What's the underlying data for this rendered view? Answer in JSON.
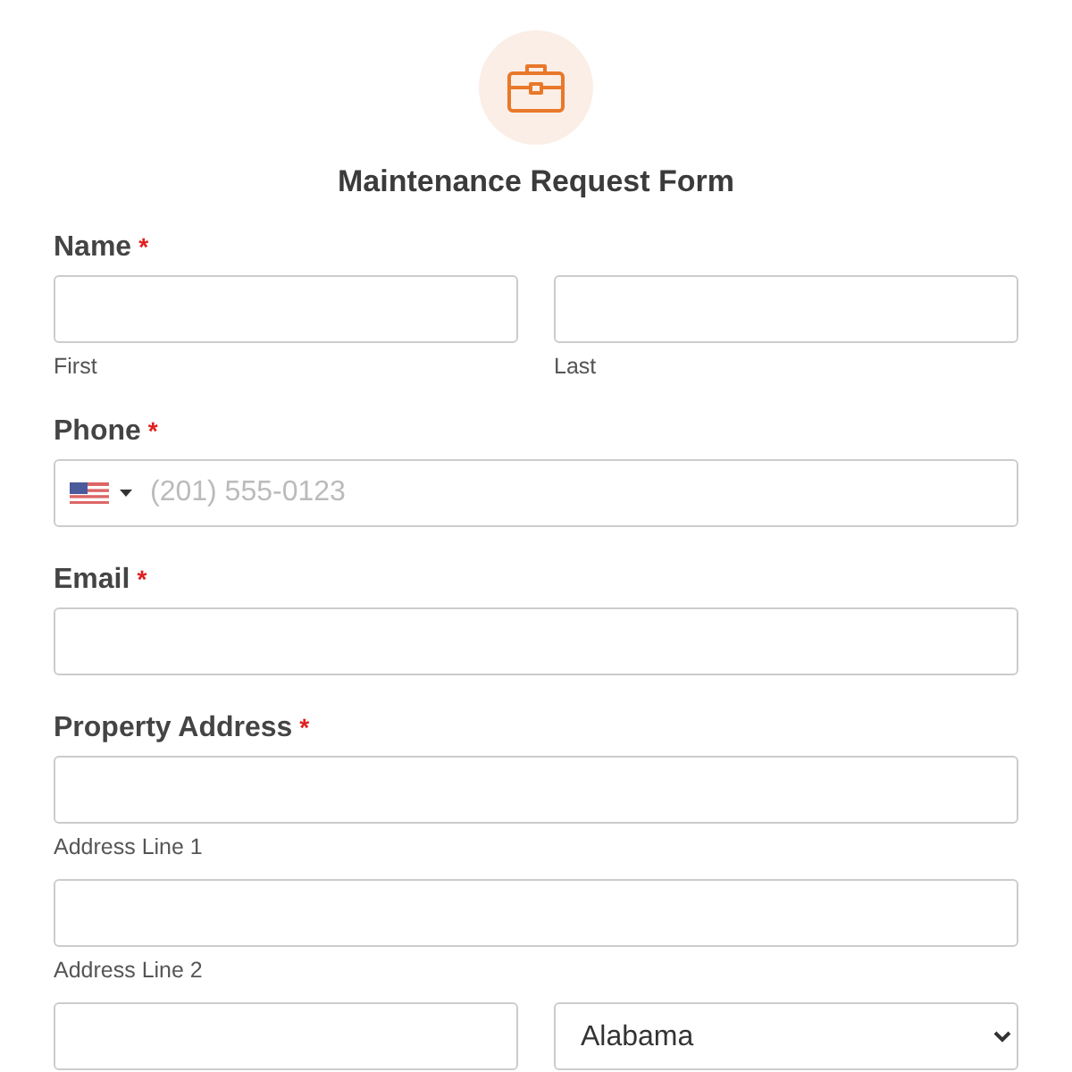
{
  "form": {
    "title": "Maintenance Request Form"
  },
  "fields": [
    {
      "label": "Name",
      "required_mark": "*",
      "rows": [
        [
          {
            "kind": "input",
            "sublabel": "First"
          },
          {
            "kind": "input",
            "sublabel": "Last"
          }
        ]
      ]
    },
    {
      "label": "Phone",
      "required_mark": "*",
      "rows": [
        [
          {
            "kind": "phone",
            "placeholder": "(201) 555-0123"
          }
        ]
      ]
    },
    {
      "label": "Email",
      "required_mark": "*",
      "rows": [
        [
          {
            "kind": "input"
          }
        ]
      ]
    },
    {
      "label": "Property Address",
      "required_mark": "*",
      "rows": [
        [
          {
            "kind": "input",
            "sublabel": "Address Line 1"
          }
        ],
        [
          {
            "kind": "input",
            "sublabel": "Address Line 2"
          }
        ],
        [
          {
            "kind": "input"
          },
          {
            "kind": "select",
            "value": "Alabama"
          }
        ]
      ]
    }
  ]
}
